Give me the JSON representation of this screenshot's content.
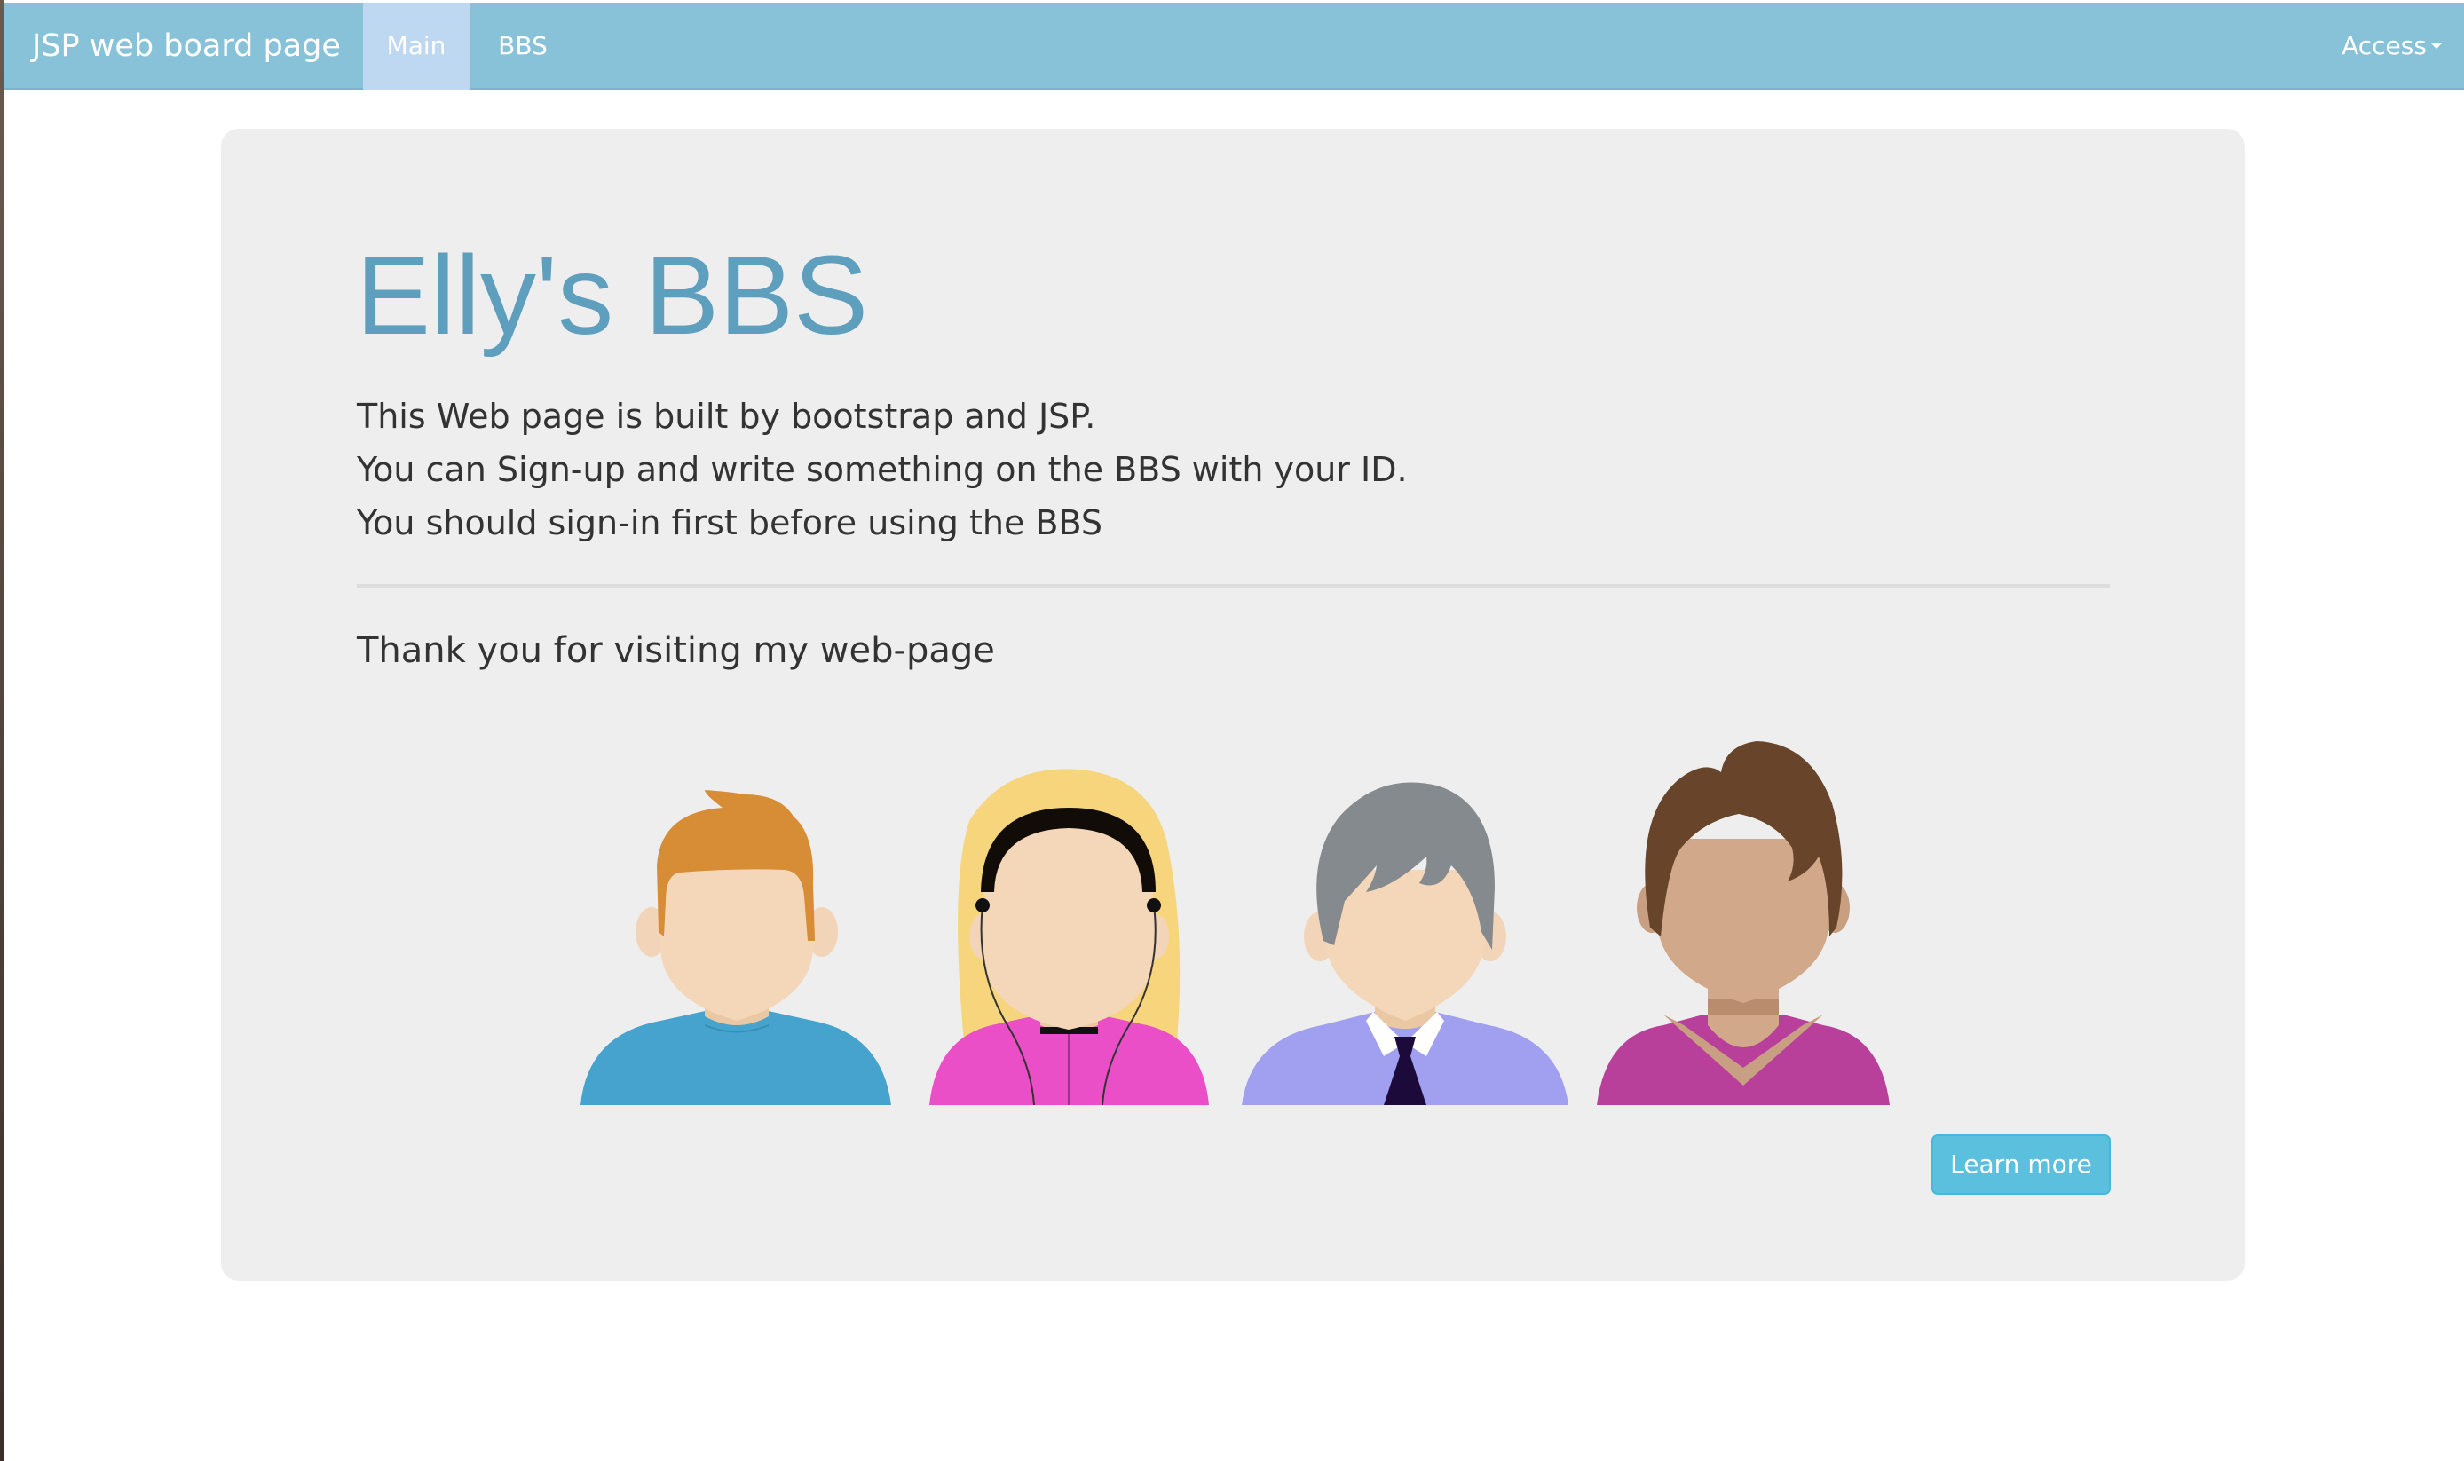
{
  "navbar": {
    "brand": "JSP web board page",
    "items": [
      {
        "label": "Main",
        "active": true
      },
      {
        "label": "BBS",
        "active": false
      }
    ],
    "access_label": "Access",
    "color": "#88c2d8",
    "active_color": "#bed8f1"
  },
  "jumbotron": {
    "title": "Elly's BBS",
    "title_color": "#5f9fbe",
    "lines": [
      "This Web page is built by bootstrap and JSP.",
      "You can Sign-up and write something on the BBS with your ID.",
      "You should sign-in first before using the BBS"
    ],
    "thanks": "Thank you for visiting my web-page",
    "button_label": "Learn more",
    "button_color": "#5bc0de"
  },
  "avatars": [
    {
      "name": "man-orange-hair-avatar"
    },
    {
      "name": "woman-blonde-headphones-avatar"
    },
    {
      "name": "man-gray-hair-tie-avatar"
    },
    {
      "name": "woman-brown-hair-avatar"
    }
  ]
}
